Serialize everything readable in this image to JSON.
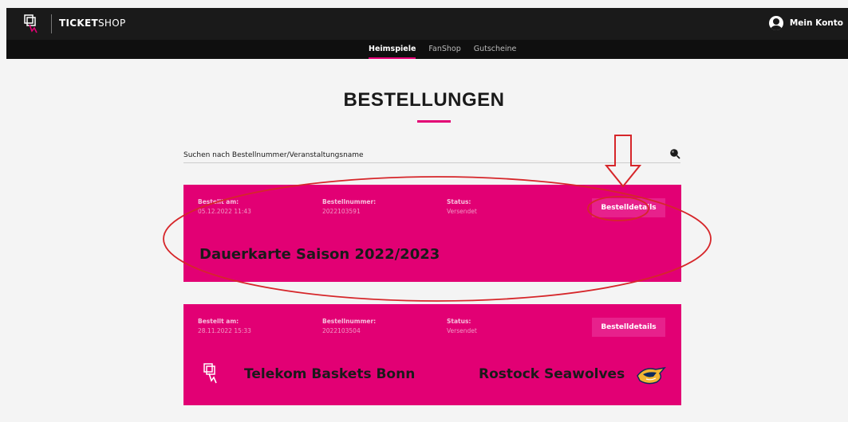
{
  "header": {
    "brand_bold": "TICKET",
    "brand_light": "SHOP",
    "account_label": "Mein Konto"
  },
  "nav": {
    "items": [
      {
        "label": "Heimspiele",
        "active": true
      },
      {
        "label": "FanShop",
        "active": false
      },
      {
        "label": "Gutscheine",
        "active": false
      }
    ]
  },
  "main": {
    "title": "BESTELLUNGEN",
    "search_placeholder": "Suchen nach Bestellnummer/Veranstaltungsname"
  },
  "orders": [
    {
      "ordered_label": "Bestellt am:",
      "ordered_value": "05.12.2022 11:43",
      "number_label": "Bestellnummer:",
      "number_value": "2022103591",
      "status_label": "Status:",
      "status_value": "Versendet",
      "details_label": "Bestelldetails",
      "title": "Dauerkarte Saison 2022/2023"
    },
    {
      "ordered_label": "Bestellt am:",
      "ordered_value": "28.11.2022 15:33",
      "number_label": "Bestellnummer:",
      "number_value": "2022103504",
      "status_label": "Status:",
      "status_value": "Versendet",
      "details_label": "Bestelldetails",
      "home_team": "Telekom Baskets Bonn",
      "away_team": "Rostock Seawolves"
    }
  ],
  "colors": {
    "accent": "#e20074",
    "header_bg": "#1a1a1a",
    "annotation": "#d6262a"
  }
}
